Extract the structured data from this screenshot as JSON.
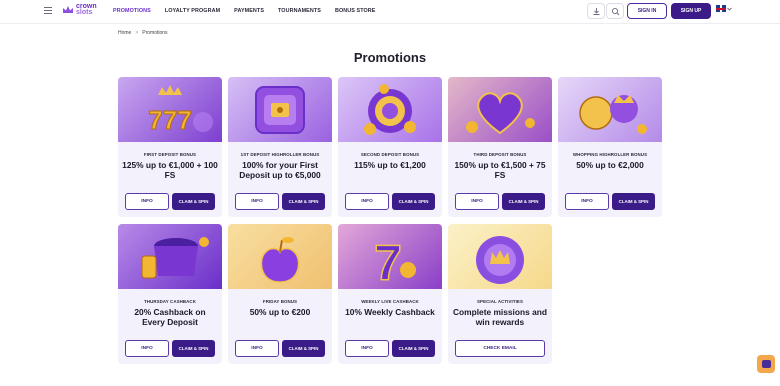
{
  "header": {
    "logo_line1": "crown",
    "logo_line2": "slots",
    "nav": [
      "PROMOTIONS",
      "LOYALTY PROGRAM",
      "PAYMENTS",
      "TOURNAMENTS",
      "BONUS STORE"
    ],
    "active_nav": "PROMOTIONS",
    "signin_label": "SIGN IN",
    "signup_label": "SIGN UP",
    "language_icon": "uk-flag-icon"
  },
  "breadcrumb": {
    "home": "Home",
    "separator": ">",
    "current": "Promotions"
  },
  "page_title": "Promotions",
  "buttons": {
    "info": "INFO",
    "claim": "CLAIM & SPIN",
    "check_email": "CHECK EMAIL"
  },
  "cards": [
    {
      "kicker": "FIRST DEPOSIT BONUS",
      "title": "125% up to €1,000 + 100 FS",
      "art": "slot-777-icon"
    },
    {
      "kicker": "1ST DEPOSIT HIGHROLLER BONUS",
      "title": "100% for your First Deposit up to €5,000",
      "art": "safe-icon"
    },
    {
      "kicker": "SECOND DEPOSIT BONUS",
      "title": "115% up to €1,200",
      "art": "coins-wheel-icon"
    },
    {
      "kicker": "THIRD DEPOSIT BONUS",
      "title": "150% up to €1,500 + 75 FS",
      "art": "heart-spade-icon"
    },
    {
      "kicker": "WHOPPING HIGHROLLER BONUS",
      "title": "50% up to €2,000",
      "art": "crown-coins-icon"
    },
    {
      "kicker": "THURSDAY CASHBACK",
      "title": "20% Cashback on Every Deposit",
      "art": "coin-pot-icon"
    },
    {
      "kicker": "FRIDAY BONUS",
      "title": "50% up to €200",
      "art": "apple-icon"
    },
    {
      "kicker": "WEEKLY LIVE CASHBACK",
      "title": "10% Weekly Cashback",
      "art": "seven-icon"
    },
    {
      "kicker": "SPECIAL ACTIVITIES",
      "title": "Complete missions and win rewards",
      "art": "chip-crown-icon"
    }
  ],
  "colors": {
    "accent": "#3b1b87",
    "card_bg": "#f3f1fb",
    "brand_purple": "#6a2fc9"
  }
}
